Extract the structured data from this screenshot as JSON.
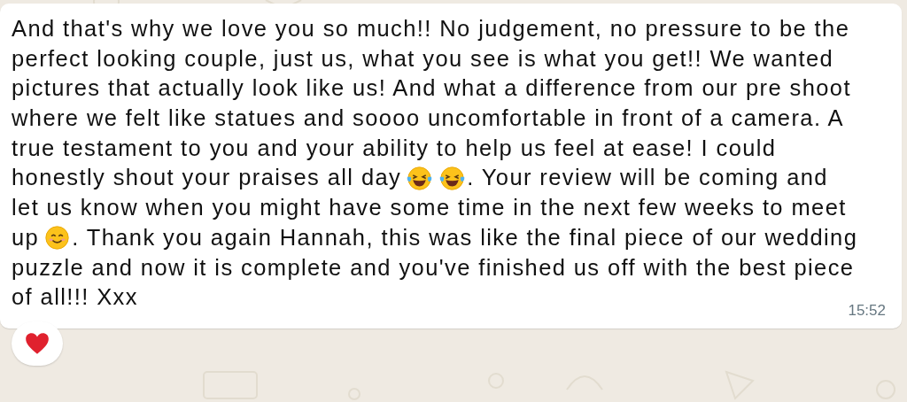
{
  "message": {
    "lines": [
      [
        {
          "kind": "text",
          "text": "And that's why we love you so much!! No judgement, no pressure to be the"
        }
      ],
      [
        {
          "kind": "text",
          "text": "perfect looking couple, just us, what you see is what you get!! We wanted"
        }
      ],
      [
        {
          "kind": "text",
          "text": "pictures that actually look like us! And what a difference from our pre shoot"
        }
      ],
      [
        {
          "kind": "text",
          "text": "where we felt like statues and soooo uncomfortable in front of a camera. A"
        }
      ],
      [
        {
          "kind": "text",
          "text": "true testament to you and your ability to help us feel at ease! I could"
        }
      ],
      [
        {
          "kind": "text",
          "text": "honestly shout your praises all day"
        },
        {
          "kind": "laugh"
        },
        {
          "kind": "laugh"
        },
        {
          "kind": "text",
          "text": ". Your review will be coming and"
        }
      ],
      [
        {
          "kind": "text",
          "text": "let us know when you might have some time in the next few weeks to meet"
        }
      ],
      [
        {
          "kind": "text",
          "text": "up"
        },
        {
          "kind": "smile"
        },
        {
          "kind": "text",
          "text": ". Thank you again Hannah, this was like the final piece of our wedding"
        }
      ],
      [
        {
          "kind": "text",
          "text": "puzzle and now it is complete and you've finished us off with the best piece"
        }
      ],
      [
        {
          "kind": "text",
          "text": "of all!!! Xxx"
        }
      ]
    ],
    "time": "15:52",
    "reaction": {
      "kind": "heart"
    }
  }
}
